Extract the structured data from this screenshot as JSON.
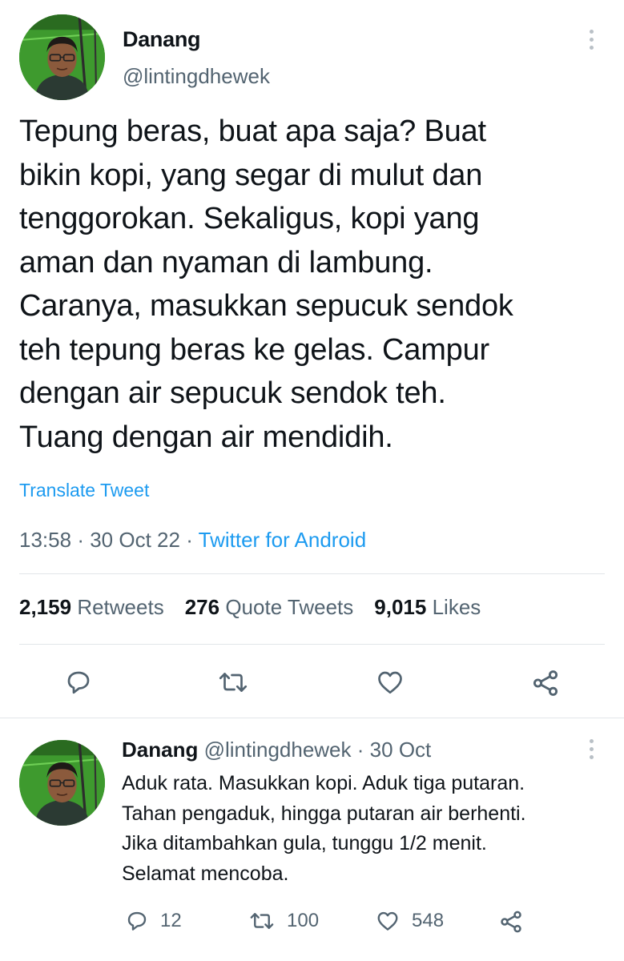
{
  "main_tweet": {
    "author_name": "Danang",
    "author_handle": "@lintingdhewek",
    "text_lines": [
      "Tepung beras, buat apa saja?  Buat",
      "bikin kopi, yang segar di mulut dan",
      "tenggorokan. Sekaligus, kopi yang",
      "aman dan nyaman di lambung.",
      "Caranya, masukkan sepucuk sendok",
      "teh tepung beras ke gelas. Campur",
      "dengan air sepucuk sendok teh.",
      "Tuang dengan air mendidih."
    ],
    "translate_label": "Translate Tweet",
    "time": "13:58",
    "separator": "·",
    "date": "30 Oct 22",
    "source": "Twitter for Android",
    "stats": {
      "retweets_count": "2,159",
      "retweets_label": "Retweets",
      "quotes_count": "276",
      "quotes_label": "Quote Tweets",
      "likes_count": "9,015",
      "likes_label": "Likes"
    },
    "actions": [
      "reply-icon",
      "retweet-icon",
      "like-icon",
      "share-icon"
    ]
  },
  "reply_tweet": {
    "author_name": "Danang",
    "author_handle": "@lintingdhewek",
    "separator": "·",
    "date": "30 Oct",
    "text_lines": [
      "Aduk rata. Masukkan kopi. Aduk tiga putaran.",
      "Tahan pengaduk, hingga putaran air berhenti.",
      "Jika ditambahkan gula, tunggu 1/2 menit.",
      "Selamat mencoba."
    ],
    "reply_count": "12",
    "retweet_count": "100",
    "like_count": "548"
  },
  "colors": {
    "text": "#0f1419",
    "secondary": "#536471",
    "link": "#1d9bf0",
    "divider": "#e2e6e9",
    "icon": "#536471"
  }
}
